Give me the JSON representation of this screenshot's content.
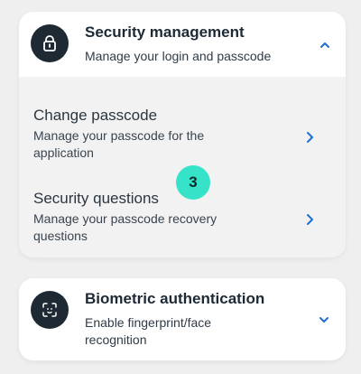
{
  "security_card": {
    "title": "Security management",
    "subtitle": "Manage your login and passcode",
    "icon": "lock-icon",
    "expanded": true,
    "options": [
      {
        "title": "Change passcode",
        "description": "Manage your passcode for the application"
      },
      {
        "title": "Security questions",
        "description": "Manage your passcode recovery questions"
      }
    ]
  },
  "biometric_card": {
    "title": "Biometric authentication",
    "subtitle": "Enable fingerprint/face recognition",
    "icon": "face-scan-icon",
    "expanded": false
  },
  "step_badge": {
    "label": "3"
  },
  "colors": {
    "accent": "#1f6fd1",
    "icon_bg": "#1f2933",
    "badge": "#37e3c8",
    "background": "#efefef",
    "expanded_bg": "#f2f2f2"
  }
}
